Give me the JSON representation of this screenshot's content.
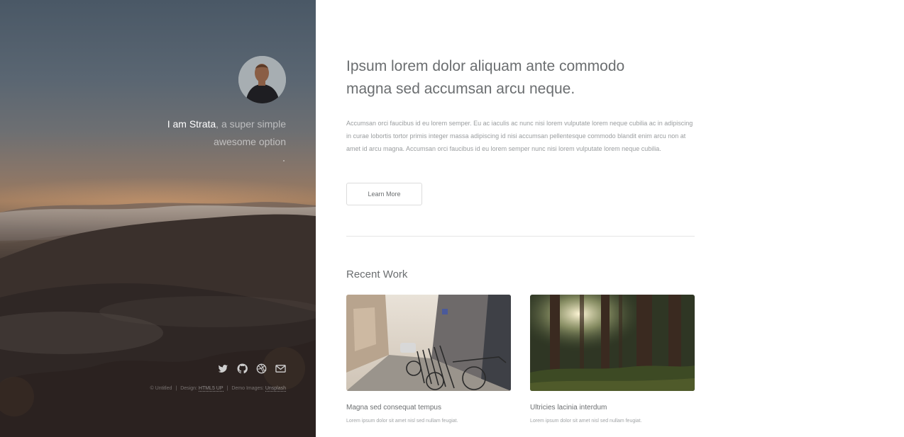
{
  "header": {
    "intro_name": "I am Strata",
    "intro_rest": ", a super simple awesome option",
    "social": [
      {
        "name": "twitter-icon",
        "label": "Twitter"
      },
      {
        "name": "github-icon",
        "label": "GitHub"
      },
      {
        "name": "dribbble-icon",
        "label": "Dribbble"
      },
      {
        "name": "email-icon",
        "label": "Email"
      }
    ],
    "copyright": {
      "text": "© Untitled",
      "design_label": "Design: ",
      "design_link": "HTML5 UP",
      "images_label": "Demo Images: ",
      "images_link": "Unsplash"
    }
  },
  "main": {
    "title_line1": "Ipsum lorem dolor aliquam ante commodo",
    "title_line2": "magna sed accumsan arcu neque.",
    "body": "Accumsan orci faucibus id eu lorem semper. Eu ac iaculis ac nunc nisi lorem vulputate lorem neque cubilia ac in adipiscing in curae lobortis tortor primis integer massa adipiscing id nisi accumsan pellentesque commodo blandit enim arcu non at amet id arcu magna. Accumsan orci faucibus id eu lorem semper nunc nisi lorem vulputate lorem neque cubilia.",
    "button_label": "Learn More",
    "recent_title": "Recent Work",
    "works": [
      {
        "title": "Magna sed consequat tempus",
        "desc": "Lorem ipsum dolor sit amet nisl sed nullam feugiat."
      },
      {
        "title": "Ultricies lacinia interdum",
        "desc": "Lorem ipsum dolor sit amet nisl sed nullam feugiat."
      }
    ]
  },
  "colors": {
    "text": "#6b6e70",
    "muted": "#9a9d9f",
    "border": "#dcdcdc"
  }
}
